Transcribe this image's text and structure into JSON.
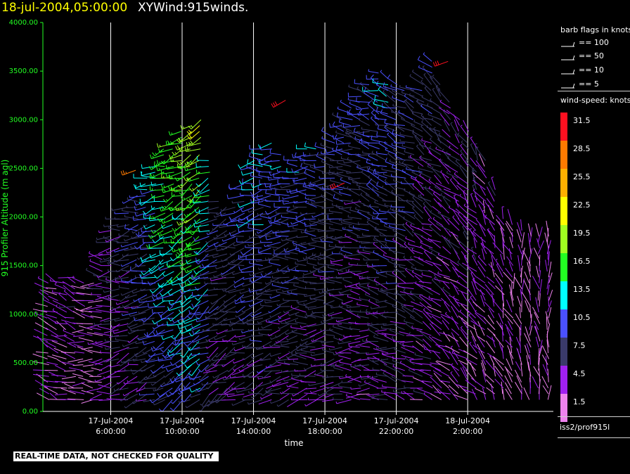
{
  "header": {
    "datetime": "18-jul-2004,05:00:00",
    "title": "XYWind:915winds."
  },
  "qc_note": "REAL-TIME DATA, NOT CHECKED FOR QUALITY",
  "colors": {
    "background": "#000000",
    "axis_y": "#22ff22",
    "axis_x": "#ffffff",
    "date_text": "#ffff00"
  },
  "legend": {
    "barb_title": "barb flags in knots",
    "barb_items": [
      "== 100",
      "== 50",
      "== 10",
      "== 5"
    ],
    "speed_title": "wind-speed: knots",
    "speed_scale": [
      {
        "label": "31.5",
        "color": "#ff1020"
      },
      {
        "label": "28.5",
        "color": "#ff7a00"
      },
      {
        "label": "25.5",
        "color": "#ffb000"
      },
      {
        "label": "22.5",
        "color": "#ffff00"
      },
      {
        "label": "19.5",
        "color": "#a0ff20"
      },
      {
        "label": "16.5",
        "color": "#22ff22"
      },
      {
        "label": "13.5",
        "color": "#00ffff"
      },
      {
        "label": "10.5",
        "color": "#4a50ff"
      },
      {
        "label": "7.5",
        "color": "#3a3a6a"
      },
      {
        "label": "4.5",
        "color": "#a020f0"
      },
      {
        "label": "1.5",
        "color": "#ee82ee"
      }
    ],
    "source": "iss2/prof915l"
  },
  "chart_data": {
    "type": "scatter",
    "subtype": "wind-barb time-height section",
    "xlabel": "time",
    "ylabel": "915 Profiler Altitude (m agl)",
    "ylim": [
      0,
      4000
    ],
    "xlim_hours": [
      2.2,
      30.8
    ],
    "y_ticks": [
      {
        "value": 0,
        "label": "0.00"
      },
      {
        "value": 500,
        "label": "500.00"
      },
      {
        "value": 1000,
        "label": "1000.00"
      },
      {
        "value": 1500,
        "label": "1500.00"
      },
      {
        "value": 2000,
        "label": "2000.00"
      },
      {
        "value": 2500,
        "label": "2500.00"
      },
      {
        "value": 3000,
        "label": "3000.00"
      },
      {
        "value": 3500,
        "label": "3500.00"
      },
      {
        "value": 4000,
        "label": "4000.00"
      }
    ],
    "x_ticks": [
      {
        "hour": 6,
        "date": "17-Jul-2004",
        "time": "6:00:00"
      },
      {
        "hour": 10,
        "date": "17-Jul-2004",
        "time": "10:00:00"
      },
      {
        "hour": 14,
        "date": "17-Jul-2004",
        "time": "14:00:00"
      },
      {
        "hour": 18,
        "date": "17-Jul-2004",
        "time": "18:00:00"
      },
      {
        "hour": 22,
        "date": "17-Jul-2004",
        "time": "22:00:00"
      },
      {
        "hour": 26,
        "date": "18-Jul-2004",
        "time": "2:00:00"
      }
    ],
    "grid": "vertical lines at labelled times",
    "profile_interval_hours": 0.5,
    "gate_spacing_m": 60,
    "profiles": [
      {
        "hour": 3.0,
        "top": 1350,
        "dir": 290,
        "spd": 4.5
      },
      {
        "hour": 4.0,
        "top": 1400,
        "dir": 280,
        "spd": 5
      },
      {
        "hour": 5.0,
        "top": 1350,
        "dir": 270,
        "spd": 4
      },
      {
        "hour": 6.0,
        "top": 1900,
        "dir": 260,
        "spd": 6
      },
      {
        "hour": 7.0,
        "top": 2100,
        "dir": 250,
        "spd": 8
      },
      {
        "hour": 8.0,
        "top": 2400,
        "dir": 245,
        "spd": 10
      },
      {
        "hour": 9.0,
        "top": 2700,
        "dir": 240,
        "spd": 14
      },
      {
        "hour": 10.0,
        "top": 2900,
        "dir": 235,
        "spd": 15
      },
      {
        "hour": 11.0,
        "top": 3000,
        "dir": 230,
        "spd": 16
      },
      {
        "hour": 12.0,
        "top": 2200,
        "dir": 240,
        "spd": 9
      },
      {
        "hour": 13.0,
        "top": 2100,
        "dir": 245,
        "spd": 8
      },
      {
        "hour": 14.0,
        "top": 2600,
        "dir": 250,
        "spd": 10
      },
      {
        "hour": 15.0,
        "top": 2800,
        "dir": 250,
        "spd": 10
      },
      {
        "hour": 16.0,
        "top": 2500,
        "dir": 255,
        "spd": 9
      },
      {
        "hour": 17.0,
        "top": 2700,
        "dir": 260,
        "spd": 9
      },
      {
        "hour": 18.0,
        "top": 2750,
        "dir": 260,
        "spd": 8
      },
      {
        "hour": 19.0,
        "top": 3000,
        "dir": 265,
        "spd": 8
      },
      {
        "hour": 20.0,
        "top": 3300,
        "dir": 270,
        "spd": 7
      },
      {
        "hour": 21.0,
        "top": 3500,
        "dir": 275,
        "spd": 8
      },
      {
        "hour": 22.0,
        "top": 3400,
        "dir": 280,
        "spd": 8
      },
      {
        "hour": 23.0,
        "top": 3300,
        "dir": 285,
        "spd": 7
      },
      {
        "hour": 24.0,
        "top": 3600,
        "dir": 290,
        "spd": 6
      },
      {
        "hour": 25.0,
        "top": 3200,
        "dir": 300,
        "spd": 5
      },
      {
        "hour": 26.0,
        "top": 2900,
        "dir": 310,
        "spd": 5
      },
      {
        "hour": 27.0,
        "top": 2600,
        "dir": 320,
        "spd": 4
      },
      {
        "hour": 28.0,
        "top": 2000,
        "dir": 330,
        "spd": 4
      },
      {
        "hour": 29.0,
        "top": 1900,
        "dir": 340,
        "spd": 3
      },
      {
        "hour": 30.0,
        "top": 1800,
        "dir": 350,
        "spd": 3
      }
    ],
    "isolated_high_winds": [
      {
        "hour": 7.4,
        "alt": 2480,
        "dir": 250,
        "spd": 28.5
      },
      {
        "hour": 15.8,
        "alt": 3200,
        "dir": 240,
        "spd": 31.5
      },
      {
        "hour": 19.1,
        "alt": 2350,
        "dir": 245,
        "spd": 31.5
      },
      {
        "hour": 24.9,
        "alt": 3600,
        "dir": 250,
        "spd": 31.5
      }
    ]
  }
}
